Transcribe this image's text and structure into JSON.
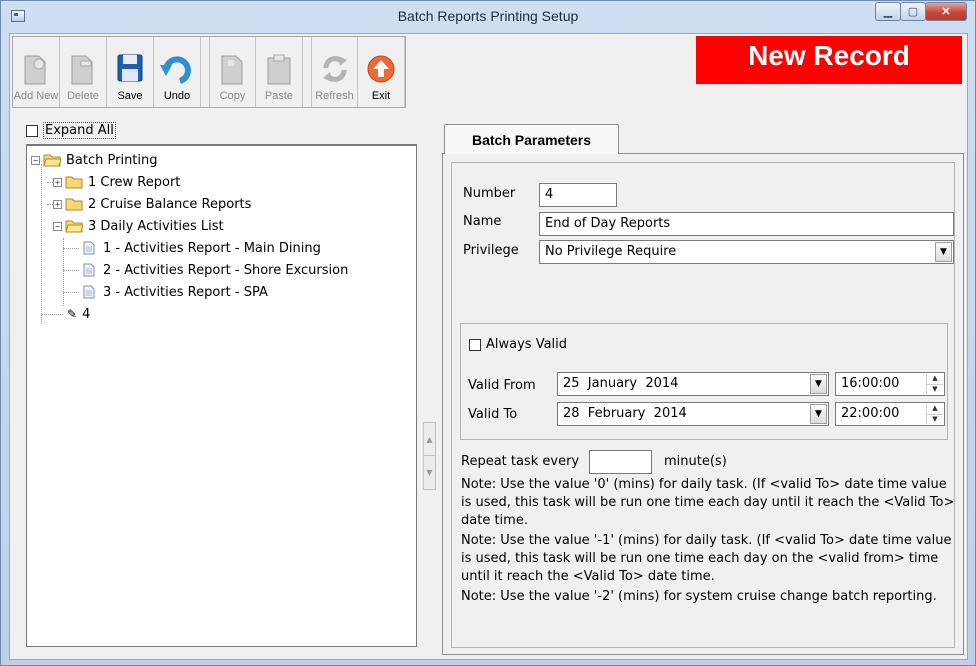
{
  "window": {
    "title": "Batch Reports Printing Setup"
  },
  "toolbar": {
    "buttons": [
      {
        "label": "Add New",
        "icon": "add-new-icon",
        "enabled": false
      },
      {
        "label": "Delete",
        "icon": "delete-icon",
        "enabled": false
      },
      {
        "label": "Save",
        "icon": "save-icon",
        "enabled": true
      },
      {
        "label": "Undo",
        "icon": "undo-icon",
        "enabled": true
      },
      {
        "label": "Copy",
        "icon": "copy-icon",
        "enabled": false
      },
      {
        "label": "Paste",
        "icon": "paste-icon",
        "enabled": false
      },
      {
        "label": "Refresh",
        "icon": "refresh-icon",
        "enabled": false
      },
      {
        "label": "Exit",
        "icon": "exit-icon",
        "enabled": true
      }
    ]
  },
  "banner": {
    "text": "New Record",
    "color": "#ff0000"
  },
  "expand_all": {
    "label": "Expand All",
    "checked": false
  },
  "tree": {
    "root": "Batch Printing",
    "items": [
      {
        "label": "1 Crew Report",
        "expanded": false
      },
      {
        "label": "2 Cruise Balance Reports",
        "expanded": false
      },
      {
        "label": "3 Daily Activities List",
        "expanded": true,
        "children": [
          "1 - Activities Report - Main Dining",
          "2 - Activities Report - Shore Excursion",
          "3 - Activities Report - SPA"
        ]
      },
      {
        "label": "4",
        "editing": true
      }
    ]
  },
  "tab": {
    "label": "Batch Parameters"
  },
  "form": {
    "number_label": "Number",
    "number_value": "4",
    "name_label": "Name",
    "name_value": "End of Day Reports",
    "privilege_label": "Privilege",
    "privilege_value": "No Privilege Require",
    "always_valid_label": "Always Valid",
    "always_valid_checked": false,
    "valid_from_label": "Valid From",
    "valid_from_date": "25  January  2014",
    "valid_from_time": "16:00:00",
    "valid_to_label": "Valid To",
    "valid_to_date": "28  February  2014",
    "valid_to_time": "22:00:00",
    "repeat_label": "Repeat task every",
    "repeat_value": "",
    "repeat_unit": "minute(s)"
  },
  "notes": [
    "Note: Use the value '0' (mins) for daily task. (If <valid To> date time value is used, this task will be run one time each day until it reach the <Valid To> date time.",
    "Note: Use the value '-1' (mins) for daily task. (If <valid To> date time value is used, this task will be run one time each day on the <valid from> time until it reach the <Valid To> date time.",
    "Note: Use the value '-2' (mins) for system cruise change batch reporting."
  ]
}
